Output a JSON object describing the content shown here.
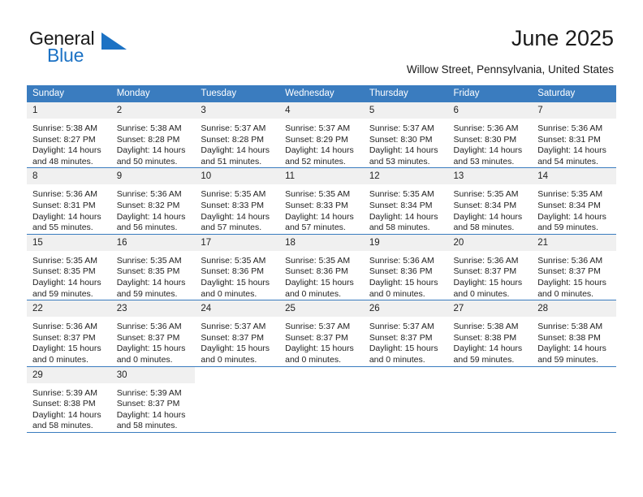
{
  "brand": {
    "name_part1": "General",
    "name_part2": "Blue",
    "mark": "triangle-logo-icon"
  },
  "header": {
    "title": "June 2025",
    "location": "Willow Street, Pennsylvania, United States"
  },
  "theme": {
    "header_blue": "#3a7cbf",
    "daynum_gray": "#f0f0f0",
    "brand_blue": "#1c72c4",
    "text": "#222222"
  },
  "calendar": {
    "weekdays": [
      "Sunday",
      "Monday",
      "Tuesday",
      "Wednesday",
      "Thursday",
      "Friday",
      "Saturday"
    ],
    "weeks": [
      [
        {
          "day": "1",
          "sunrise": "Sunrise: 5:38 AM",
          "sunset": "Sunset: 8:27 PM",
          "daylight": "Daylight: 14 hours and 48 minutes."
        },
        {
          "day": "2",
          "sunrise": "Sunrise: 5:38 AM",
          "sunset": "Sunset: 8:28 PM",
          "daylight": "Daylight: 14 hours and 50 minutes."
        },
        {
          "day": "3",
          "sunrise": "Sunrise: 5:37 AM",
          "sunset": "Sunset: 8:28 PM",
          "daylight": "Daylight: 14 hours and 51 minutes."
        },
        {
          "day": "4",
          "sunrise": "Sunrise: 5:37 AM",
          "sunset": "Sunset: 8:29 PM",
          "daylight": "Daylight: 14 hours and 52 minutes."
        },
        {
          "day": "5",
          "sunrise": "Sunrise: 5:37 AM",
          "sunset": "Sunset: 8:30 PM",
          "daylight": "Daylight: 14 hours and 53 minutes."
        },
        {
          "day": "6",
          "sunrise": "Sunrise: 5:36 AM",
          "sunset": "Sunset: 8:30 PM",
          "daylight": "Daylight: 14 hours and 53 minutes."
        },
        {
          "day": "7",
          "sunrise": "Sunrise: 5:36 AM",
          "sunset": "Sunset: 8:31 PM",
          "daylight": "Daylight: 14 hours and 54 minutes."
        }
      ],
      [
        {
          "day": "8",
          "sunrise": "Sunrise: 5:36 AM",
          "sunset": "Sunset: 8:31 PM",
          "daylight": "Daylight: 14 hours and 55 minutes."
        },
        {
          "day": "9",
          "sunrise": "Sunrise: 5:36 AM",
          "sunset": "Sunset: 8:32 PM",
          "daylight": "Daylight: 14 hours and 56 minutes."
        },
        {
          "day": "10",
          "sunrise": "Sunrise: 5:35 AM",
          "sunset": "Sunset: 8:33 PM",
          "daylight": "Daylight: 14 hours and 57 minutes."
        },
        {
          "day": "11",
          "sunrise": "Sunrise: 5:35 AM",
          "sunset": "Sunset: 8:33 PM",
          "daylight": "Daylight: 14 hours and 57 minutes."
        },
        {
          "day": "12",
          "sunrise": "Sunrise: 5:35 AM",
          "sunset": "Sunset: 8:34 PM",
          "daylight": "Daylight: 14 hours and 58 minutes."
        },
        {
          "day": "13",
          "sunrise": "Sunrise: 5:35 AM",
          "sunset": "Sunset: 8:34 PM",
          "daylight": "Daylight: 14 hours and 58 minutes."
        },
        {
          "day": "14",
          "sunrise": "Sunrise: 5:35 AM",
          "sunset": "Sunset: 8:34 PM",
          "daylight": "Daylight: 14 hours and 59 minutes."
        }
      ],
      [
        {
          "day": "15",
          "sunrise": "Sunrise: 5:35 AM",
          "sunset": "Sunset: 8:35 PM",
          "daylight": "Daylight: 14 hours and 59 minutes."
        },
        {
          "day": "16",
          "sunrise": "Sunrise: 5:35 AM",
          "sunset": "Sunset: 8:35 PM",
          "daylight": "Daylight: 14 hours and 59 minutes."
        },
        {
          "day": "17",
          "sunrise": "Sunrise: 5:35 AM",
          "sunset": "Sunset: 8:36 PM",
          "daylight": "Daylight: 15 hours and 0 minutes."
        },
        {
          "day": "18",
          "sunrise": "Sunrise: 5:35 AM",
          "sunset": "Sunset: 8:36 PM",
          "daylight": "Daylight: 15 hours and 0 minutes."
        },
        {
          "day": "19",
          "sunrise": "Sunrise: 5:36 AM",
          "sunset": "Sunset: 8:36 PM",
          "daylight": "Daylight: 15 hours and 0 minutes."
        },
        {
          "day": "20",
          "sunrise": "Sunrise: 5:36 AM",
          "sunset": "Sunset: 8:37 PM",
          "daylight": "Daylight: 15 hours and 0 minutes."
        },
        {
          "day": "21",
          "sunrise": "Sunrise: 5:36 AM",
          "sunset": "Sunset: 8:37 PM",
          "daylight": "Daylight: 15 hours and 0 minutes."
        }
      ],
      [
        {
          "day": "22",
          "sunrise": "Sunrise: 5:36 AM",
          "sunset": "Sunset: 8:37 PM",
          "daylight": "Daylight: 15 hours and 0 minutes."
        },
        {
          "day": "23",
          "sunrise": "Sunrise: 5:36 AM",
          "sunset": "Sunset: 8:37 PM",
          "daylight": "Daylight: 15 hours and 0 minutes."
        },
        {
          "day": "24",
          "sunrise": "Sunrise: 5:37 AM",
          "sunset": "Sunset: 8:37 PM",
          "daylight": "Daylight: 15 hours and 0 minutes."
        },
        {
          "day": "25",
          "sunrise": "Sunrise: 5:37 AM",
          "sunset": "Sunset: 8:37 PM",
          "daylight": "Daylight: 15 hours and 0 minutes."
        },
        {
          "day": "26",
          "sunrise": "Sunrise: 5:37 AM",
          "sunset": "Sunset: 8:37 PM",
          "daylight": "Daylight: 15 hours and 0 minutes."
        },
        {
          "day": "27",
          "sunrise": "Sunrise: 5:38 AM",
          "sunset": "Sunset: 8:38 PM",
          "daylight": "Daylight: 14 hours and 59 minutes."
        },
        {
          "day": "28",
          "sunrise": "Sunrise: 5:38 AM",
          "sunset": "Sunset: 8:38 PM",
          "daylight": "Daylight: 14 hours and 59 minutes."
        }
      ],
      [
        {
          "day": "29",
          "sunrise": "Sunrise: 5:39 AM",
          "sunset": "Sunset: 8:38 PM",
          "daylight": "Daylight: 14 hours and 58 minutes."
        },
        {
          "day": "30",
          "sunrise": "Sunrise: 5:39 AM",
          "sunset": "Sunset: 8:37 PM",
          "daylight": "Daylight: 14 hours and 58 minutes."
        },
        {
          "day": "",
          "sunrise": "",
          "sunset": "",
          "daylight": ""
        },
        {
          "day": "",
          "sunrise": "",
          "sunset": "",
          "daylight": ""
        },
        {
          "day": "",
          "sunrise": "",
          "sunset": "",
          "daylight": ""
        },
        {
          "day": "",
          "sunrise": "",
          "sunset": "",
          "daylight": ""
        },
        {
          "day": "",
          "sunrise": "",
          "sunset": "",
          "daylight": ""
        }
      ]
    ]
  }
}
